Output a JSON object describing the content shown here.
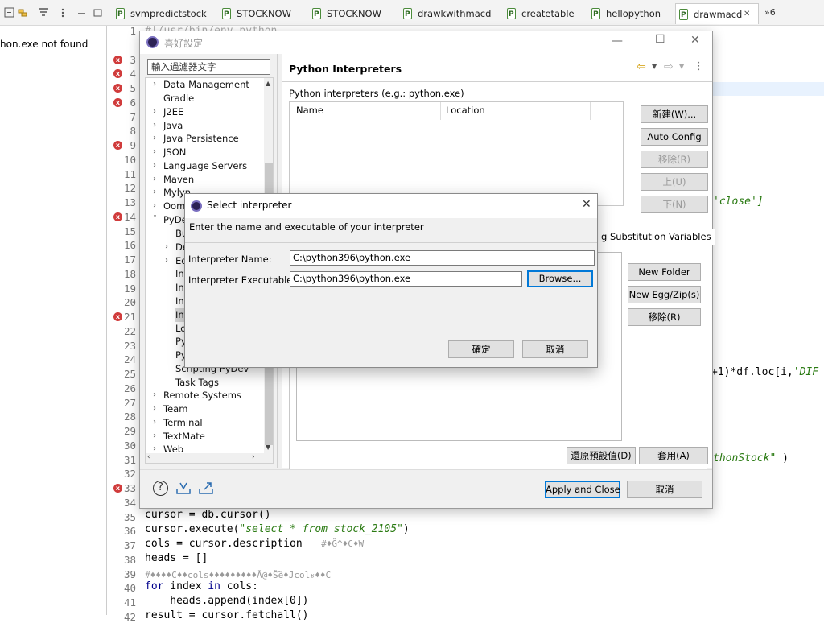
{
  "tabs": [
    {
      "label": "svmpredictstock"
    },
    {
      "label": "STOCKNOW"
    },
    {
      "label": "STOCKNOW"
    },
    {
      "label": "drawkwithmacd"
    },
    {
      "label": "createtable"
    },
    {
      "label": "hellopython"
    },
    {
      "label": "drawmacd"
    }
  ],
  "tab_close": "✕",
  "tab_overflow": "»6",
  "console_text": "hon.exe not found",
  "editor": {
    "line_numbers": [
      "1",
      "3",
      "4",
      "5",
      "6",
      "7",
      "8",
      "9",
      "10",
      "11",
      "12",
      "13",
      "14",
      "15",
      "16",
      "17",
      "18",
      "19",
      "20",
      "21",
      "22",
      "23",
      "24",
      "25",
      "26",
      "27",
      "28",
      "29",
      "30",
      "31",
      "32",
      "33",
      "34",
      "35",
      "36",
      "37",
      "38",
      "39",
      "40",
      "41",
      "42"
    ],
    "line1_partial": "#!/usr/bin/env python",
    "frag_close": "'close']",
    "frag_diff_pre": "+1)*df.loc[i,",
    "frag_diff_str": "'DIF",
    "frag_stock_str": "thonStock\"",
    "frag_stock_paren": " )",
    "l35": "cursor = db.cursor()",
    "l36_a": "cursor.execute(",
    "l36_str": "\"select * from stock_2105\"",
    "l36_b": ")",
    "l37": "cols = cursor.description",
    "l37_cmt": "#♦G̃^♦C♦W",
    "l38": "heads = []",
    "l39": "#♦♦♦♦C♦♦cols♦♦♦♦♦♦♦♦♦Ā@♦Šeิ♦Jcolะ♦♦C",
    "l40_kw": "for",
    "l40_a": " index ",
    "l40_kw2": "in",
    "l40_b": " cols:",
    "l41": "    heads.append(index[0])",
    "l42": "result = cursor.fetchall()"
  },
  "pref": {
    "title": "喜好設定",
    "filter_placeholder": "輸入過濾器文字",
    "tree": [
      "Data Management",
      "Gradle",
      "J2EE",
      "Java",
      "Java Persistence",
      "JSON",
      "Language Servers",
      "Maven",
      "Mylyn",
      "Oomph",
      "PyDev",
      "Bu",
      "De",
      "Ed",
      "Int",
      "Int",
      "Int",
      "Int",
      "Lo",
      "Py",
      "Py",
      "Scripting PyDev",
      "Task Tags",
      "Remote Systems",
      "Team",
      "Terminal",
      "TextMate",
      "Web"
    ],
    "header": "Python Interpreters",
    "interp_label": "Python interpreters (e.g.: python.exe)",
    "col_name": "Name",
    "col_location": "Location",
    "btn_new": "新建(W)...",
    "btn_auto": "Auto Config",
    "btn_remove": "移除(R)",
    "btn_up": "上(U)",
    "btn_down": "下(N)",
    "subtab_strings": "g Substitution Variables",
    "btn_new_folder": "New Folder",
    "btn_new_egg": "New Egg/Zip(s)",
    "btn_remove2": "移除(R)",
    "btn_restore": "還原預設值(D)",
    "btn_apply": "套用(A)",
    "btn_apply_close": "Apply and Close",
    "btn_cancel": "取消"
  },
  "select": {
    "title": "Select interpreter",
    "subtitle": "Enter the name and executable of your interpreter",
    "name_label": "Interpreter Name:",
    "name_value": "C:\\python396\\python.exe",
    "exe_label": "Interpreter Executable:",
    "exe_value": "C:\\python396\\python.exe",
    "browse": "Browse...",
    "ok": "確定",
    "cancel": "取消",
    "close": "✕"
  }
}
